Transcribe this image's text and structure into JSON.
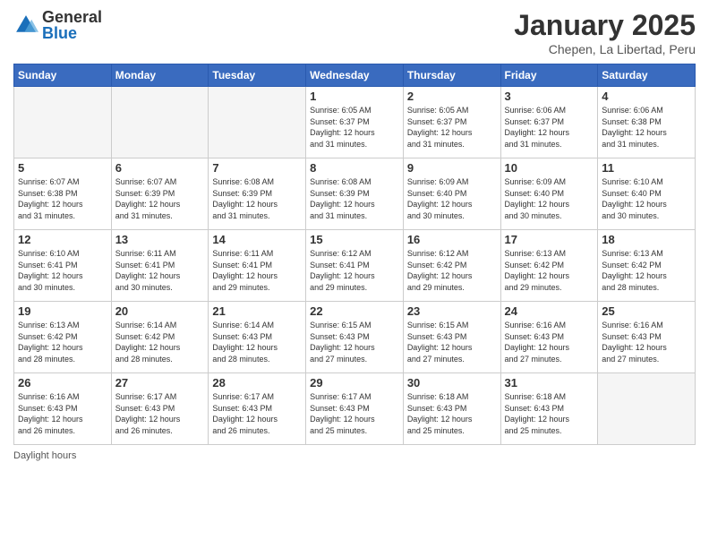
{
  "header": {
    "logo": {
      "general": "General",
      "blue": "Blue"
    },
    "month": "January 2025",
    "location": "Chepen, La Libertad, Peru"
  },
  "weekdays": [
    "Sunday",
    "Monday",
    "Tuesday",
    "Wednesday",
    "Thursday",
    "Friday",
    "Saturday"
  ],
  "weeks": [
    [
      {
        "day": "",
        "info": ""
      },
      {
        "day": "",
        "info": ""
      },
      {
        "day": "",
        "info": ""
      },
      {
        "day": "1",
        "info": "Sunrise: 6:05 AM\nSunset: 6:37 PM\nDaylight: 12 hours\nand 31 minutes."
      },
      {
        "day": "2",
        "info": "Sunrise: 6:05 AM\nSunset: 6:37 PM\nDaylight: 12 hours\nand 31 minutes."
      },
      {
        "day": "3",
        "info": "Sunrise: 6:06 AM\nSunset: 6:37 PM\nDaylight: 12 hours\nand 31 minutes."
      },
      {
        "day": "4",
        "info": "Sunrise: 6:06 AM\nSunset: 6:38 PM\nDaylight: 12 hours\nand 31 minutes."
      }
    ],
    [
      {
        "day": "5",
        "info": "Sunrise: 6:07 AM\nSunset: 6:38 PM\nDaylight: 12 hours\nand 31 minutes."
      },
      {
        "day": "6",
        "info": "Sunrise: 6:07 AM\nSunset: 6:39 PM\nDaylight: 12 hours\nand 31 minutes."
      },
      {
        "day": "7",
        "info": "Sunrise: 6:08 AM\nSunset: 6:39 PM\nDaylight: 12 hours\nand 31 minutes."
      },
      {
        "day": "8",
        "info": "Sunrise: 6:08 AM\nSunset: 6:39 PM\nDaylight: 12 hours\nand 31 minutes."
      },
      {
        "day": "9",
        "info": "Sunrise: 6:09 AM\nSunset: 6:40 PM\nDaylight: 12 hours\nand 30 minutes."
      },
      {
        "day": "10",
        "info": "Sunrise: 6:09 AM\nSunset: 6:40 PM\nDaylight: 12 hours\nand 30 minutes."
      },
      {
        "day": "11",
        "info": "Sunrise: 6:10 AM\nSunset: 6:40 PM\nDaylight: 12 hours\nand 30 minutes."
      }
    ],
    [
      {
        "day": "12",
        "info": "Sunrise: 6:10 AM\nSunset: 6:41 PM\nDaylight: 12 hours\nand 30 minutes."
      },
      {
        "day": "13",
        "info": "Sunrise: 6:11 AM\nSunset: 6:41 PM\nDaylight: 12 hours\nand 30 minutes."
      },
      {
        "day": "14",
        "info": "Sunrise: 6:11 AM\nSunset: 6:41 PM\nDaylight: 12 hours\nand 29 minutes."
      },
      {
        "day": "15",
        "info": "Sunrise: 6:12 AM\nSunset: 6:41 PM\nDaylight: 12 hours\nand 29 minutes."
      },
      {
        "day": "16",
        "info": "Sunrise: 6:12 AM\nSunset: 6:42 PM\nDaylight: 12 hours\nand 29 minutes."
      },
      {
        "day": "17",
        "info": "Sunrise: 6:13 AM\nSunset: 6:42 PM\nDaylight: 12 hours\nand 29 minutes."
      },
      {
        "day": "18",
        "info": "Sunrise: 6:13 AM\nSunset: 6:42 PM\nDaylight: 12 hours\nand 28 minutes."
      }
    ],
    [
      {
        "day": "19",
        "info": "Sunrise: 6:13 AM\nSunset: 6:42 PM\nDaylight: 12 hours\nand 28 minutes."
      },
      {
        "day": "20",
        "info": "Sunrise: 6:14 AM\nSunset: 6:42 PM\nDaylight: 12 hours\nand 28 minutes."
      },
      {
        "day": "21",
        "info": "Sunrise: 6:14 AM\nSunset: 6:43 PM\nDaylight: 12 hours\nand 28 minutes."
      },
      {
        "day": "22",
        "info": "Sunrise: 6:15 AM\nSunset: 6:43 PM\nDaylight: 12 hours\nand 27 minutes."
      },
      {
        "day": "23",
        "info": "Sunrise: 6:15 AM\nSunset: 6:43 PM\nDaylight: 12 hours\nand 27 minutes."
      },
      {
        "day": "24",
        "info": "Sunrise: 6:16 AM\nSunset: 6:43 PM\nDaylight: 12 hours\nand 27 minutes."
      },
      {
        "day": "25",
        "info": "Sunrise: 6:16 AM\nSunset: 6:43 PM\nDaylight: 12 hours\nand 27 minutes."
      }
    ],
    [
      {
        "day": "26",
        "info": "Sunrise: 6:16 AM\nSunset: 6:43 PM\nDaylight: 12 hours\nand 26 minutes."
      },
      {
        "day": "27",
        "info": "Sunrise: 6:17 AM\nSunset: 6:43 PM\nDaylight: 12 hours\nand 26 minutes."
      },
      {
        "day": "28",
        "info": "Sunrise: 6:17 AM\nSunset: 6:43 PM\nDaylight: 12 hours\nand 26 minutes."
      },
      {
        "day": "29",
        "info": "Sunrise: 6:17 AM\nSunset: 6:43 PM\nDaylight: 12 hours\nand 25 minutes."
      },
      {
        "day": "30",
        "info": "Sunrise: 6:18 AM\nSunset: 6:43 PM\nDaylight: 12 hours\nand 25 minutes."
      },
      {
        "day": "31",
        "info": "Sunrise: 6:18 AM\nSunset: 6:43 PM\nDaylight: 12 hours\nand 25 minutes."
      },
      {
        "day": "",
        "info": ""
      }
    ]
  ],
  "footer": {
    "daylight_label": "Daylight hours"
  }
}
